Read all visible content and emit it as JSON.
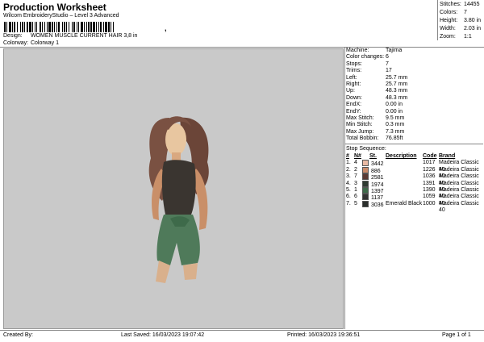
{
  "header": {
    "title": "Production Worksheet",
    "subtitle": "Wilcom EmbroideryStudio – Level 3 Advanced",
    "barcode_sep": ","
  },
  "info": {
    "design_label": "Design:",
    "design_value": "WOMEN MUSCLE CURRENT HAIR 3,8 in",
    "colorway_label": "Colorway:",
    "colorway_value": "Colorway 1"
  },
  "stats": [
    {
      "label": "Stitches:",
      "value": "14455"
    },
    {
      "label": "Colors:",
      "value": "7"
    },
    {
      "label": "Height:",
      "value": "3.80 in"
    },
    {
      "label": "Width:",
      "value": "2.03 in"
    },
    {
      "label": "Zoom:",
      "value": "1:1"
    }
  ],
  "machine_info": [
    {
      "label": "Machine:",
      "value": "Tajima"
    },
    {
      "label": "Color changes:",
      "value": "6"
    },
    {
      "label": "Stops:",
      "value": "7"
    },
    {
      "label": "Trims:",
      "value": "17"
    },
    {
      "label": "Left:",
      "value": "25.7 mm"
    },
    {
      "label": "Right:",
      "value": "25.7 mm"
    },
    {
      "label": "Up:",
      "value": "48.3 mm"
    },
    {
      "label": "Down:",
      "value": "48.3 mm"
    },
    {
      "label": "EndX:",
      "value": "0.00 in"
    },
    {
      "label": "EndY:",
      "value": "0.00 in"
    },
    {
      "label": "Max Stitch:",
      "value": "9.5 mm"
    },
    {
      "label": "Min Stitch:",
      "value": "0.3 mm"
    },
    {
      "label": "Max Jump:",
      "value": "7.3 mm"
    },
    {
      "label": "Total Bobbin:",
      "value": "76.85ft"
    }
  ],
  "stop_sequence": {
    "title": "Stop Sequence:",
    "headers": [
      "#",
      "N#",
      "St.",
      "Description",
      "Code",
      "Brand"
    ],
    "rows": [
      {
        "idx": "1.",
        "n": "4",
        "color": "#e9b9a3",
        "st": "3442",
        "desc": "",
        "code": "1017",
        "brand": "Madeira Classic 40"
      },
      {
        "idx": "2.",
        "n": "2",
        "color": "#c98a6a",
        "st": "886",
        "desc": "",
        "code": "1226",
        "brand": "Madeira Classic 40"
      },
      {
        "idx": "3.",
        "n": "7",
        "color": "#5a3a34",
        "st": "2581",
        "desc": "",
        "code": "1036",
        "brand": "Madeira Classic 40"
      },
      {
        "idx": "4.",
        "n": "3",
        "color": "#2f3a32",
        "st": "1974",
        "desc": "",
        "code": "1391",
        "brand": "Madeira Classic 40"
      },
      {
        "idx": "5.",
        "n": "1",
        "color": "#3e6a4a",
        "st": "1397",
        "desc": "",
        "code": "1390",
        "brand": "Madeira Classic 40"
      },
      {
        "idx": "6.",
        "n": "6",
        "color": "#333333",
        "st": "1137",
        "desc": "",
        "code": "1059",
        "brand": "Madeira Classic 40"
      },
      {
        "idx": "7.",
        "n": "5",
        "color": "#2a2f2c",
        "st": "3036",
        "desc": "Emerald Black",
        "code": "1000",
        "brand": "Madeira Classic 40"
      }
    ]
  },
  "footer": {
    "created_by": "Created By:",
    "last_saved": "Last Saved: 16/03/2023 19:07:42",
    "printed": "Printed: 16/03/2023 19:36:51",
    "page": "Page 1 of 1"
  }
}
